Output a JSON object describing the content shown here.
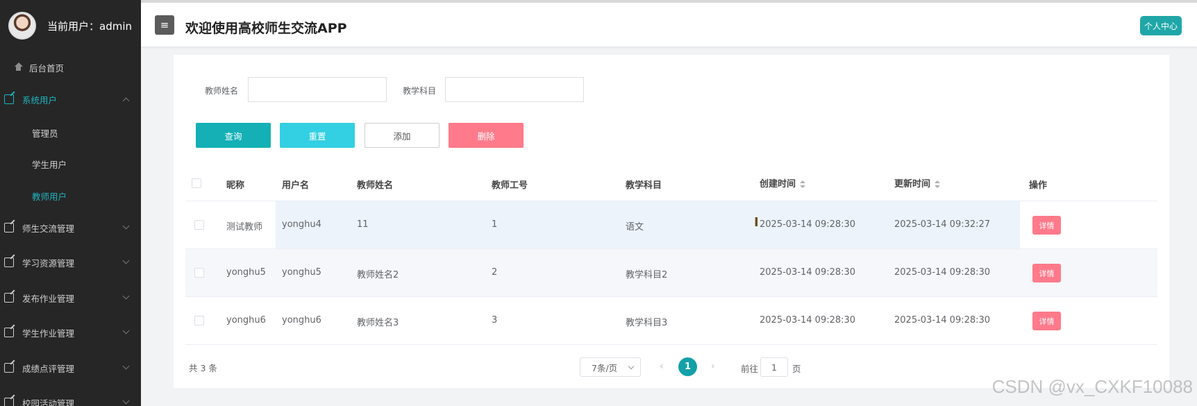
{
  "sidebar": {
    "user_label": "当前用户：admin",
    "items": [
      {
        "label": "后台首页"
      },
      {
        "label": "系统用户"
      },
      {
        "label": "管理员"
      },
      {
        "label": "学生用户"
      },
      {
        "label": "教师用户"
      },
      {
        "label": "师生交流管理"
      },
      {
        "label": "学习资源管理"
      },
      {
        "label": "发布作业管理"
      },
      {
        "label": "学生作业管理"
      },
      {
        "label": "成绩点评管理"
      },
      {
        "label": "校园活动管理"
      }
    ]
  },
  "header": {
    "menu_icon": "≡",
    "title": "欢迎使用高校师生交流APP",
    "profile_button": "个人中心"
  },
  "search": {
    "name_label": "教师姓名",
    "name_value": "",
    "subject_label": "教学科目",
    "subject_value": ""
  },
  "actions": {
    "query": "查询",
    "reset": "重置",
    "add": "添加",
    "delete": "删除"
  },
  "table": {
    "headers": [
      "昵称",
      "用户名",
      "教师姓名",
      "教师工号",
      "教学科目",
      "创建时间",
      "更新时间",
      "操作"
    ],
    "rows": [
      {
        "nickname": "测试教师",
        "username": "yonghu4",
        "name": "11",
        "number": "1",
        "subject": "语文",
        "created": "2025-03-14 09:28:30",
        "updated": "2025-03-14 09:32:27",
        "action": "详情"
      },
      {
        "nickname": "yonghu5",
        "username": "yonghu5",
        "name": "教师姓名2",
        "number": "2",
        "subject": "教学科目2",
        "created": "2025-03-14 09:28:30",
        "updated": "2025-03-14 09:28:30",
        "action": "详情"
      },
      {
        "nickname": "yonghu6",
        "username": "yonghu6",
        "name": "教师姓名3",
        "number": "3",
        "subject": "教学科目3",
        "created": "2025-03-14 09:28:30",
        "updated": "2025-03-14 09:28:30",
        "action": "详情"
      }
    ]
  },
  "pagination": {
    "total": "共 3 条",
    "page_size": "7条/页",
    "prev": "‹",
    "current_page": "1",
    "next": "›",
    "goto_label": "前往",
    "goto_value": "1",
    "goto_unit": "页"
  },
  "cursor_glyph": "I",
  "watermark": "CSDN @vx_CXKF10088",
  "colors": {
    "sidebar_bg": "#262626",
    "accent": "#14b0b5",
    "danger": "#ff7a8a"
  }
}
